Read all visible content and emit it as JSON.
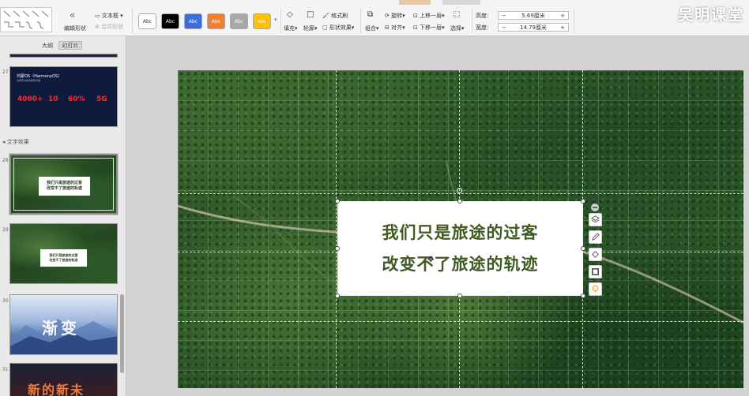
{
  "watermark": "吴明课堂",
  "ribbon": {
    "edit_shape": "编辑形状",
    "merge_shape": "合并形状",
    "text_box": "文本框",
    "swatch_label": "Abc",
    "fill": "填充",
    "outline": "轮廓",
    "format_painter": "格式刷",
    "shape_effects": "形状效果",
    "combine": "组合",
    "rotate": "旋转",
    "align": "对齐",
    "bring_forward": "上移一层",
    "send_backward": "下移一层",
    "select": "选择",
    "height_label": "高度:",
    "height_value": "5.69厘米",
    "width_label": "宽度:",
    "width_value": "14.79厘米",
    "swatch_colors": [
      "#ffffff",
      "#000000",
      "#3d6ed8",
      "#f07f2e",
      "#a8a8a8",
      "#ffc000"
    ]
  },
  "panel": {
    "tab_outline": "大纲",
    "tab_slides": "幻灯片",
    "section_label": "文字效果",
    "slide27": {
      "number": "27",
      "title": "鸿蒙OS（HarmonyOS）",
      "subtitle": "全场景分布式操作系统",
      "stats": [
        "4000+",
        "10",
        "60%",
        "5G"
      ]
    },
    "slide28": {
      "number": "28"
    },
    "slide29": {
      "number": "29"
    },
    "slide30": {
      "number": "30",
      "text": "渐变"
    },
    "slide31": {
      "number": "31",
      "text": "新的新未"
    }
  },
  "slide": {
    "line1": "我们只是旅途的过客",
    "line2": "改变不了旅途的轨迹"
  }
}
